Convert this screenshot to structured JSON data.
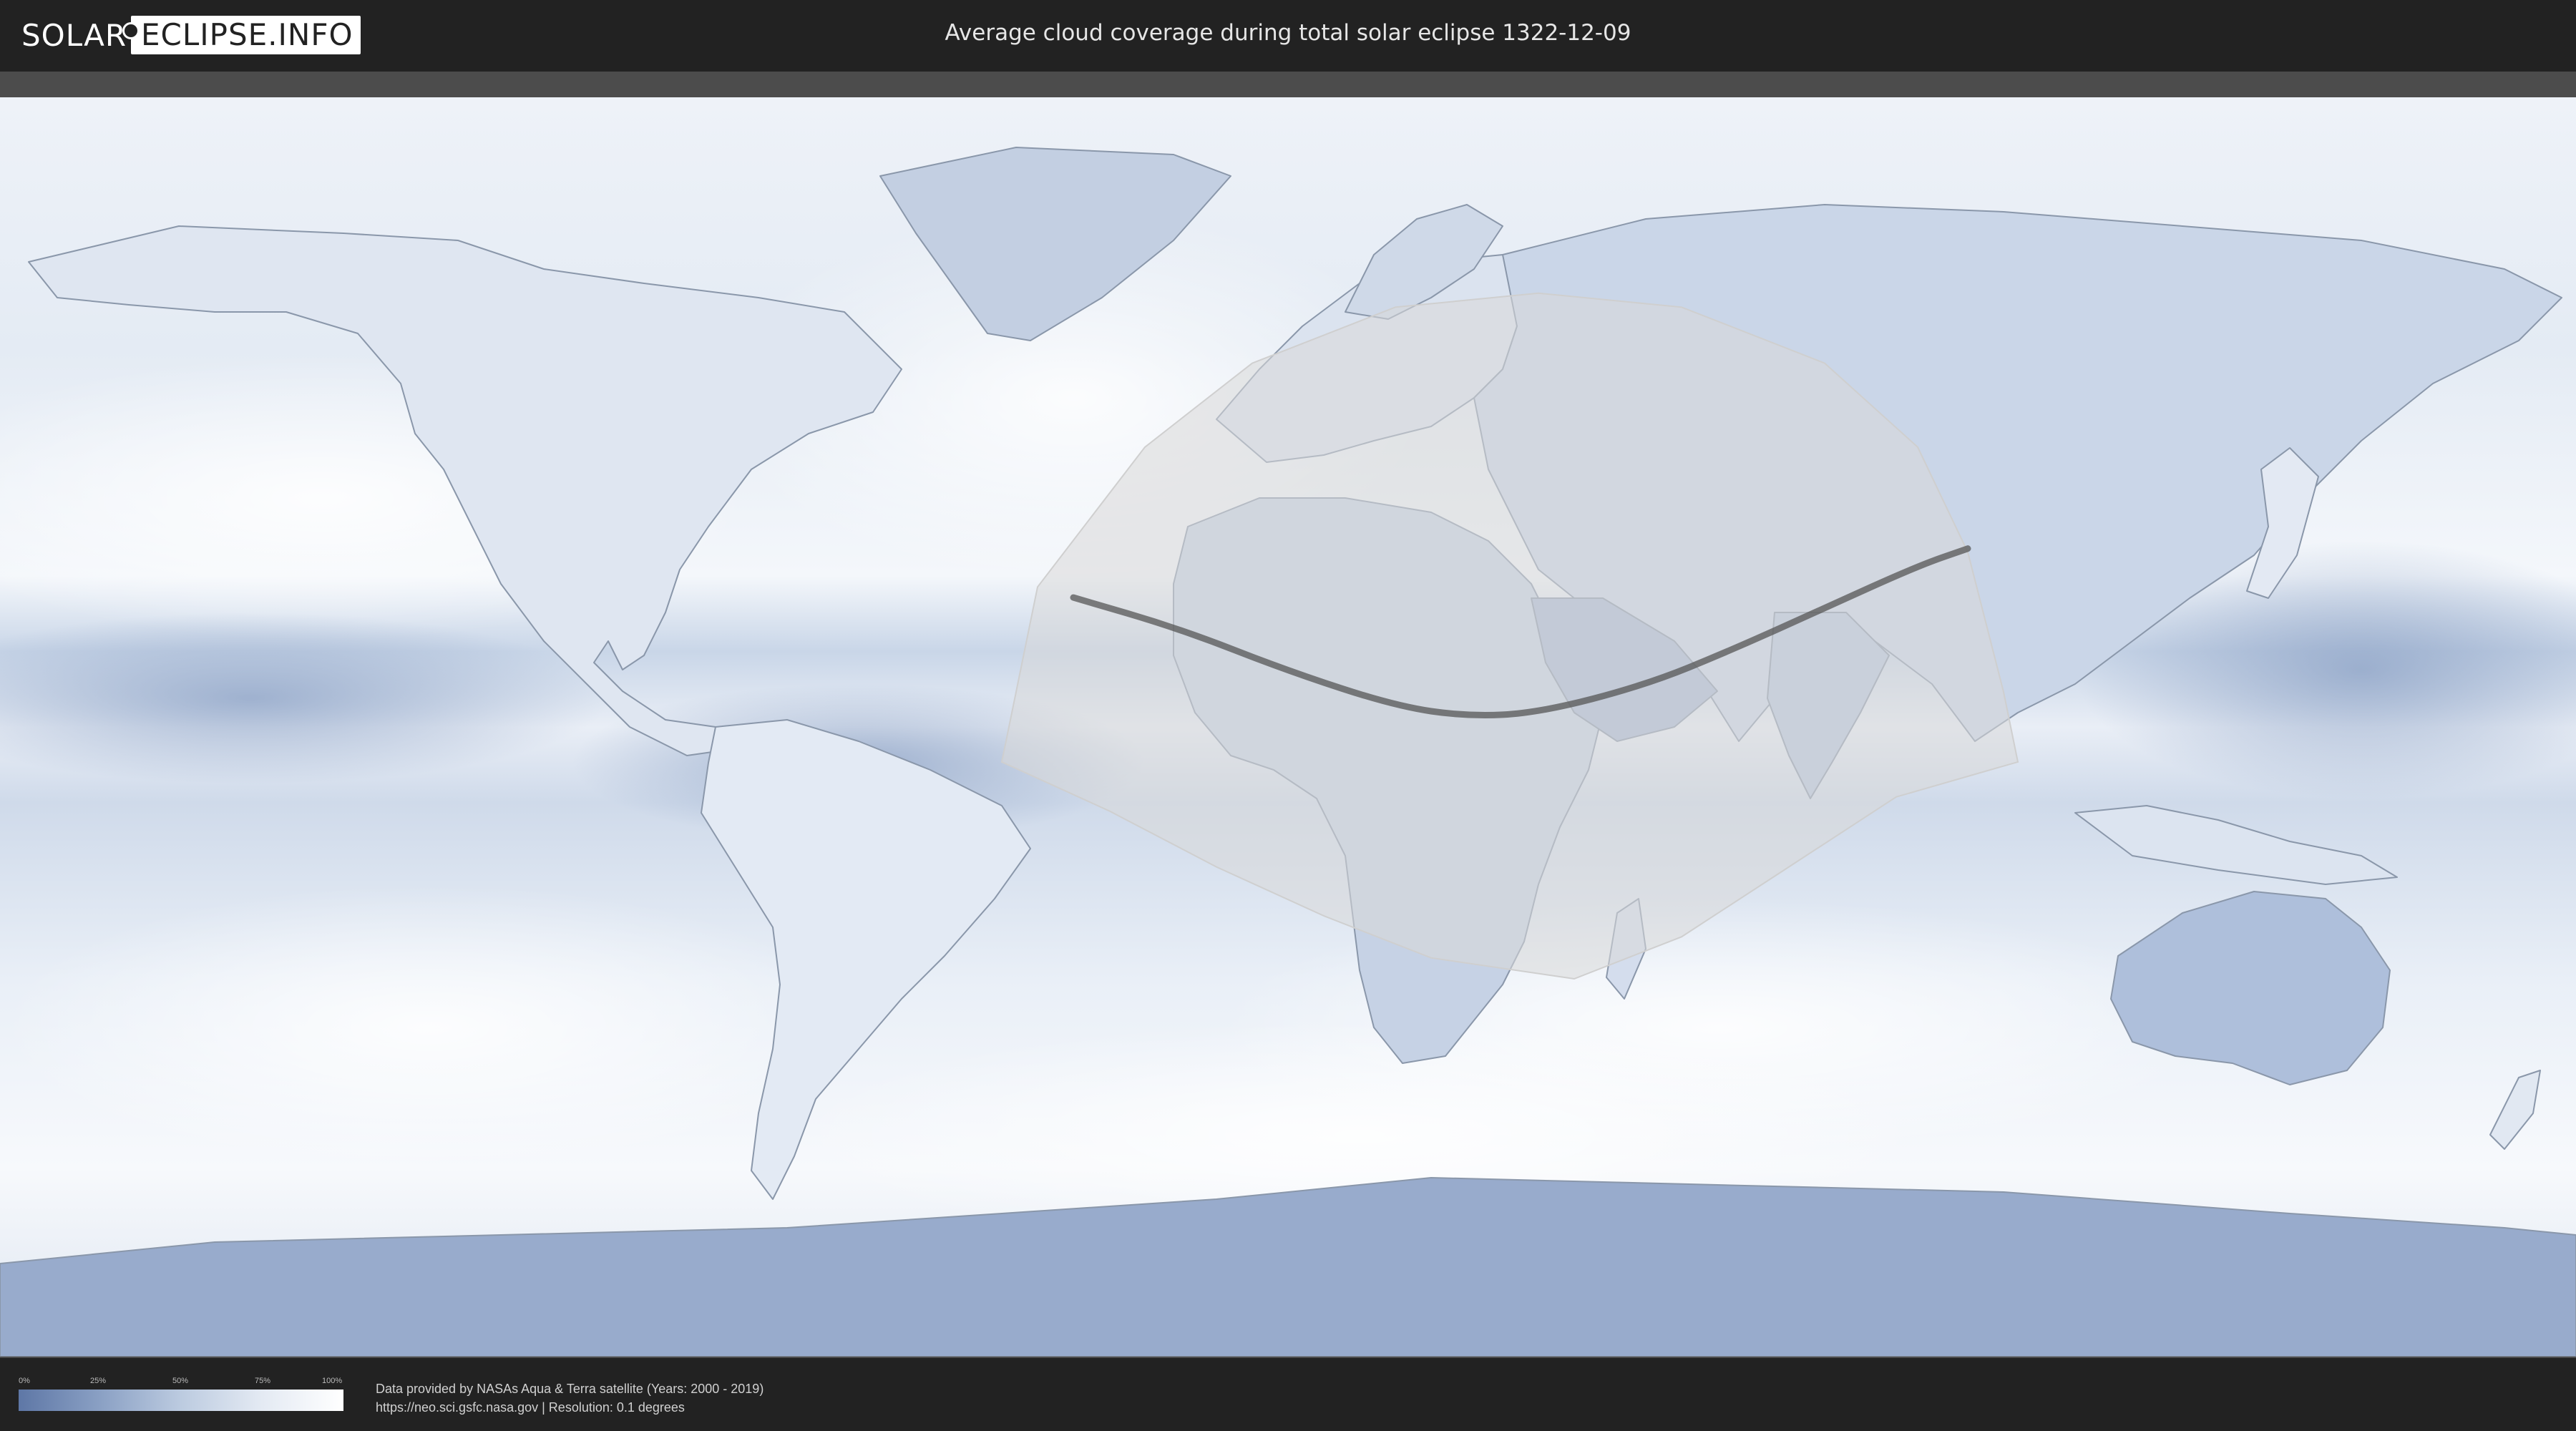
{
  "header": {
    "logo_left": "SOLAR",
    "logo_right": "ECLIPSE.INFO",
    "title": "Average cloud coverage during total solar eclipse 1322-12-09"
  },
  "map": {
    "projection": "equirectangular",
    "central_path": {
      "description_color": "#555555",
      "lon_lat": [
        [
          -30,
          18.5
        ],
        [
          -15,
          14
        ],
        [
          0,
          8
        ],
        [
          15,
          3
        ],
        [
          25,
          1.5
        ],
        [
          35,
          2
        ],
        [
          50,
          6
        ],
        [
          62,
          11
        ],
        [
          75,
          17
        ],
        [
          88,
          23
        ],
        [
          95,
          25.5
        ]
      ]
    },
    "visibility_zone": {
      "fill": "#d8d8d8",
      "lon_lat": [
        [
          -40,
          -5
        ],
        [
          -35,
          20
        ],
        [
          -20,
          40
        ],
        [
          -5,
          52
        ],
        [
          15,
          60
        ],
        [
          35,
          62
        ],
        [
          55,
          60
        ],
        [
          75,
          52
        ],
        [
          88,
          40
        ],
        [
          95,
          25
        ],
        [
          100,
          5
        ],
        [
          102,
          -5
        ],
        [
          85,
          -10
        ],
        [
          70,
          -20
        ],
        [
          55,
          -30
        ],
        [
          40,
          -36
        ],
        [
          20,
          -33
        ],
        [
          5,
          -27
        ],
        [
          -10,
          -20
        ],
        [
          -25,
          -12
        ]
      ]
    },
    "colors": {
      "ocean_cloud_high": "#e9eef6",
      "cloud_clear": "#ffffff",
      "low_cloud": "#8ea2c4",
      "very_low_cloud": "#6f86b0",
      "coastline": "#8a97aa"
    }
  },
  "legend": {
    "ticks": [
      "0%",
      "25%",
      "50%",
      "75%",
      "100%"
    ],
    "tick_values": [
      0,
      25,
      50,
      75,
      100
    ]
  },
  "credit": {
    "line1": "Data provided by NASAs Aqua & Terra satellite (Years: 2000 - 2019)",
    "line2": "https://neo.sci.gsfc.nasa.gov | Resolution: 0.1 degrees"
  }
}
